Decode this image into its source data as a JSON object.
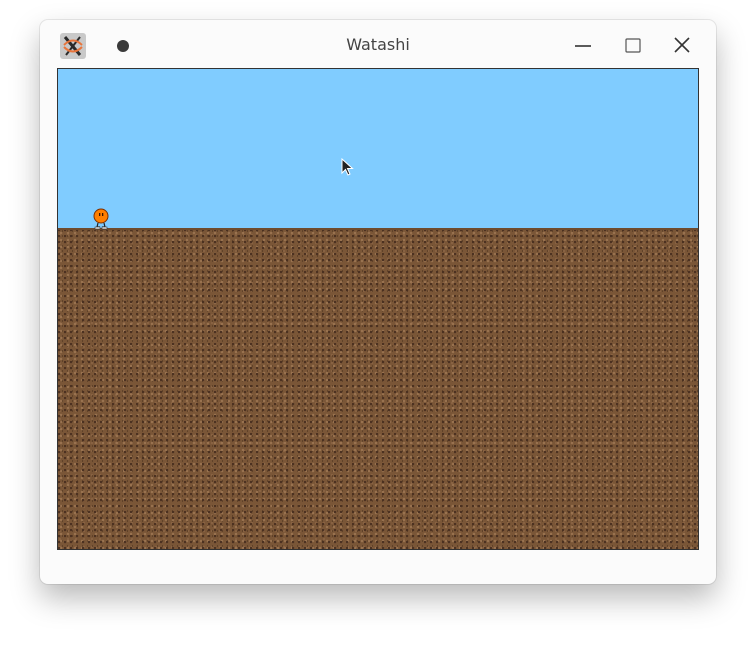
{
  "window": {
    "title": "Watashi",
    "controls": {
      "minimize": "minimize-icon",
      "maximize": "maximize-icon",
      "close": "close-icon"
    },
    "app_icon": "x-app-icon"
  },
  "game": {
    "sky_color": "#80ccff",
    "ground_color": "#7a5637",
    "player": {
      "icon": "orange-character-icon",
      "color": "#ff7f00"
    },
    "cursor": "mouse-pointer-icon"
  }
}
